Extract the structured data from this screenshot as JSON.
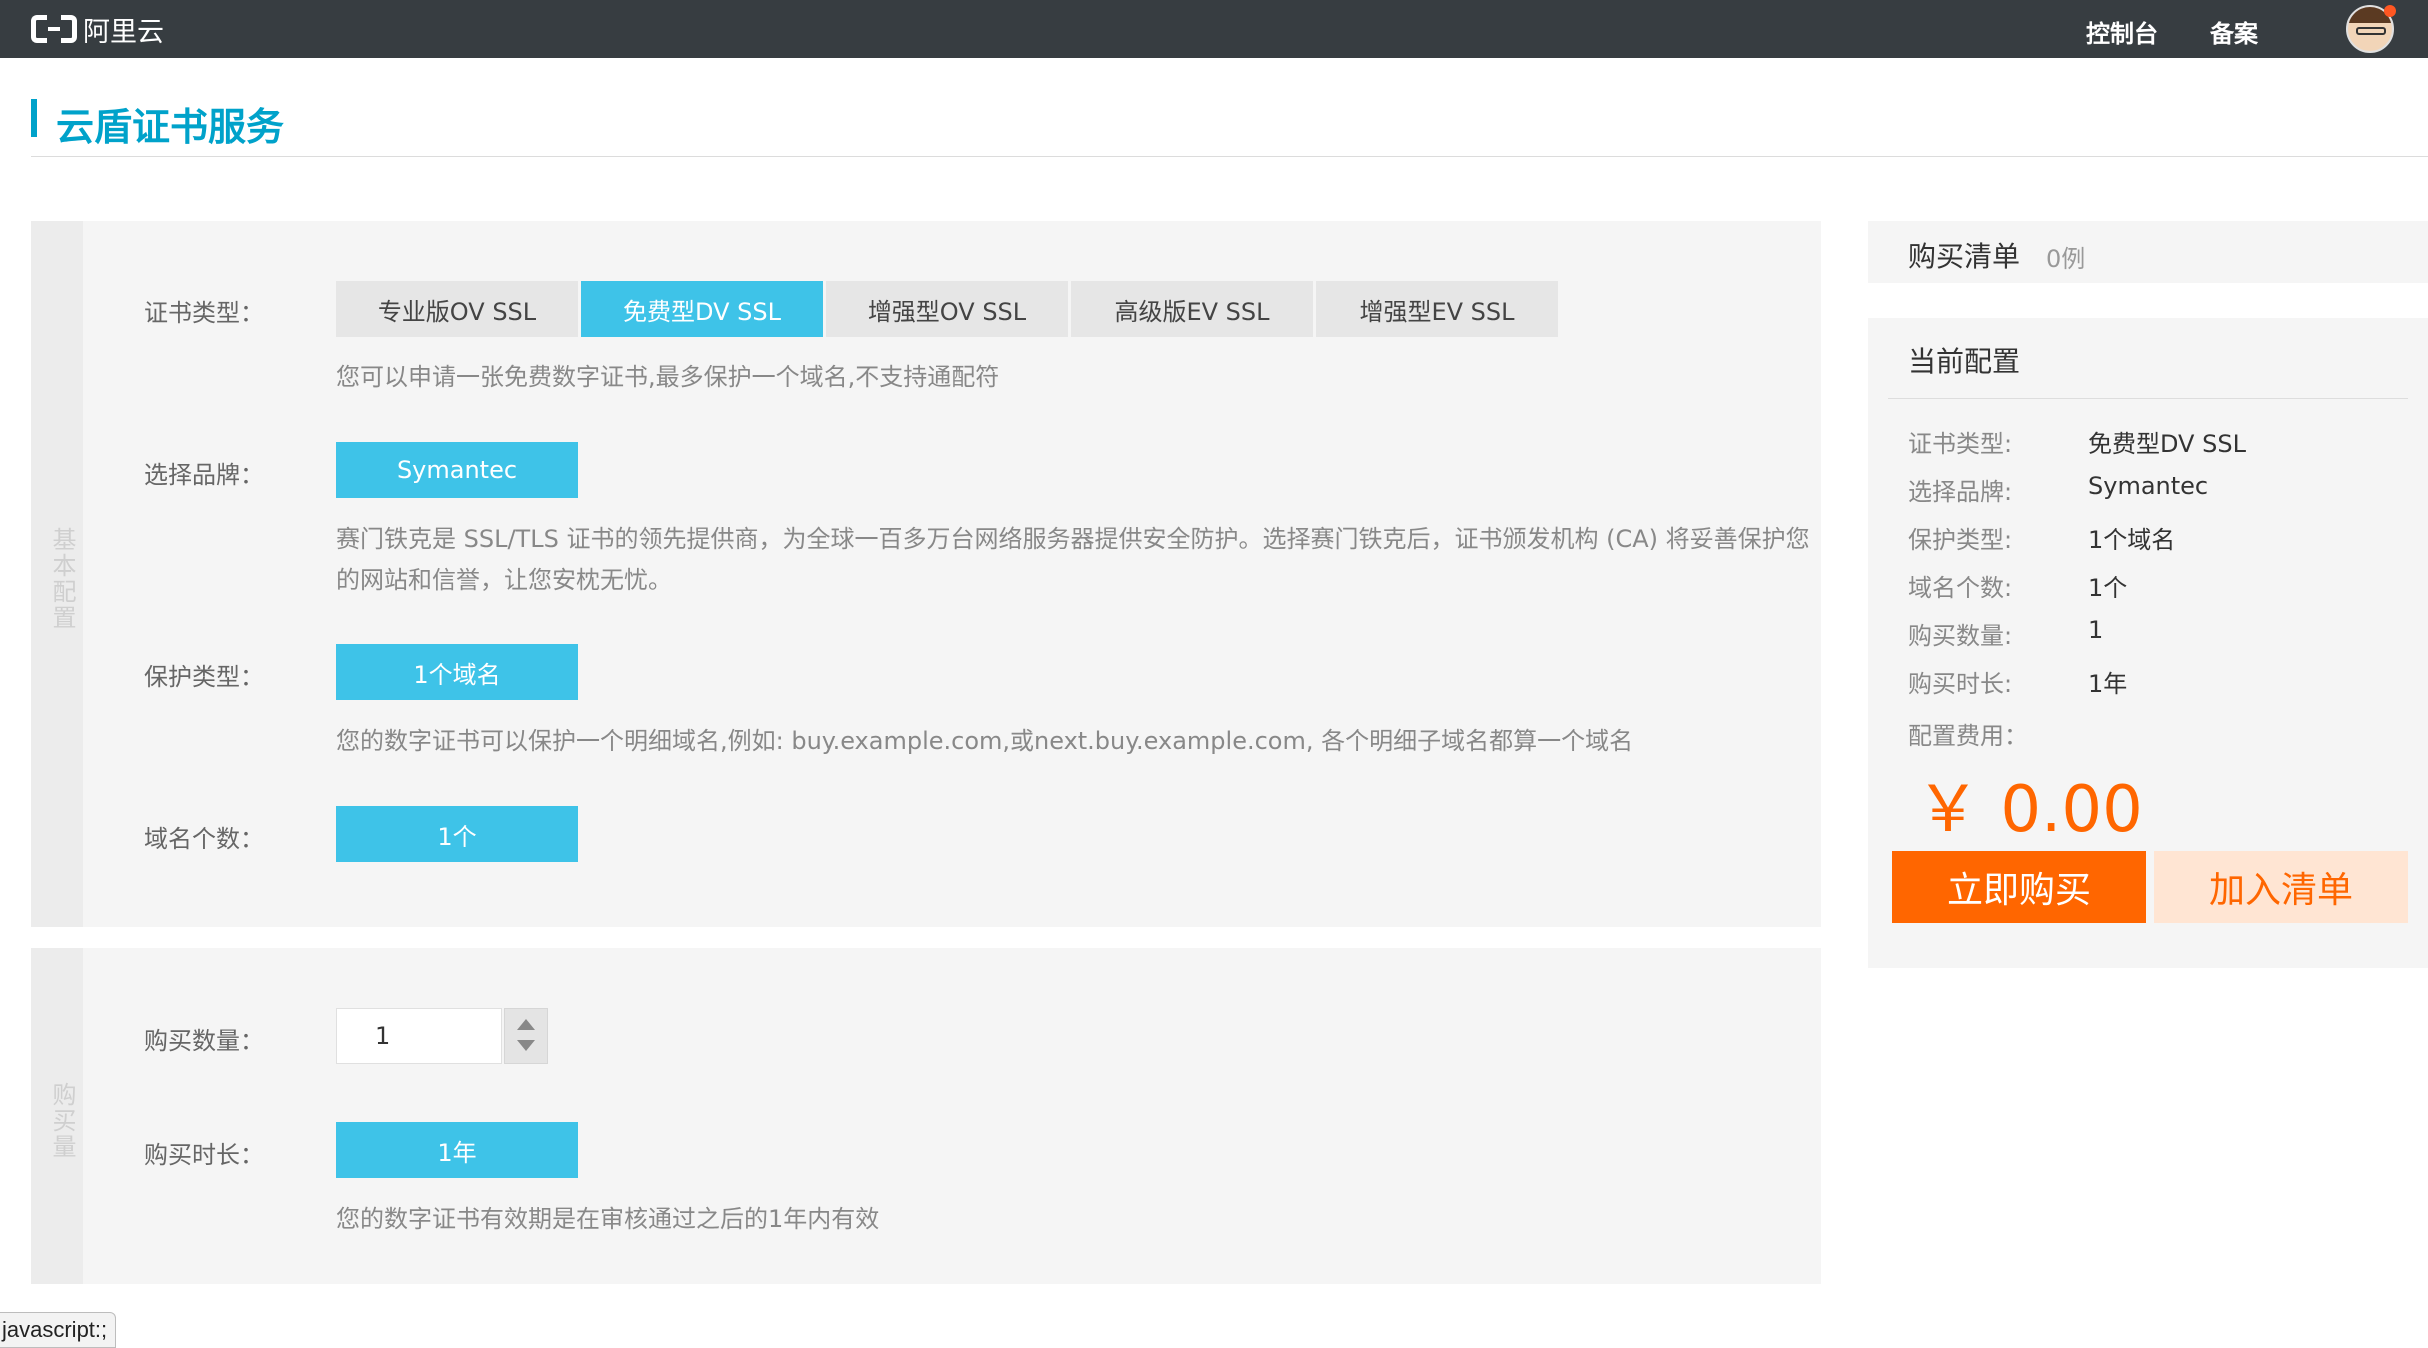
{
  "topbar": {
    "logo_text": "阿里云",
    "nav": [
      "控制台",
      "备案"
    ]
  },
  "page": {
    "title": "云盾证书服务"
  },
  "basic_config": {
    "section_label": "基本配置",
    "cert_type": {
      "label": "证书类型：",
      "options": [
        "专业版OV SSL",
        "免费型DV SSL",
        "增强型OV SSL",
        "高级版EV SSL",
        "增强型EV SSL"
      ],
      "selected": "免费型DV SSL",
      "desc": "您可以申请一张免费数字证书,最多保护一个域名,不支持通配符"
    },
    "brand": {
      "label": "选择品牌：",
      "value": "Symantec",
      "desc_line1": "赛门铁克是 SSL/TLS 证书的领先提供商，为全球一百多万台网络服务器提供安全防护。选择赛门铁克后，证书颁发机构 (CA) 将妥善保护您",
      "desc_line2": "的网站和信誉，让您安枕无忧。"
    },
    "protect_type": {
      "label": "保护类型：",
      "value": "1个域名",
      "desc": "您的数字证书可以保护一个明细域名,例如: buy.example.com,或next.buy.example.com, 各个明细子域名都算一个域名"
    },
    "domain_count": {
      "label": "域名个数：",
      "value": "1个"
    }
  },
  "purchase": {
    "section_label": "购买量",
    "quantity": {
      "label": "购买数量：",
      "value": "1"
    },
    "duration": {
      "label": "购买时长：",
      "value": "1年",
      "desc": "您的数字证书有效期是在审核通过之后的1年内有效"
    }
  },
  "cart": {
    "title": "购买清单",
    "count": "0例"
  },
  "current_config": {
    "title": "当前配置",
    "rows": [
      {
        "key": "证书类型:",
        "value": "免费型DV SSL"
      },
      {
        "key": "选择品牌:",
        "value": "Symantec"
      },
      {
        "key": "保护类型:",
        "value": "1个域名"
      },
      {
        "key": "域名个数:",
        "value": "1个"
      },
      {
        "key": "购买数量:",
        "value": "1"
      },
      {
        "key": "购买时长:",
        "value": "1年"
      }
    ],
    "fee_label": "配置费用：",
    "price": "￥ 0.00",
    "buy_label": "立即购买",
    "add_label": "加入清单"
  },
  "status_bar": {
    "url": "javascript:;"
  },
  "colors": {
    "accent": "#00a2ca",
    "option_active": "#3ec3e8",
    "price": "#ff6600",
    "buy_button": "#ff6600",
    "cart_button_bg": "#ffe5d3",
    "topbar": "#373d41"
  }
}
